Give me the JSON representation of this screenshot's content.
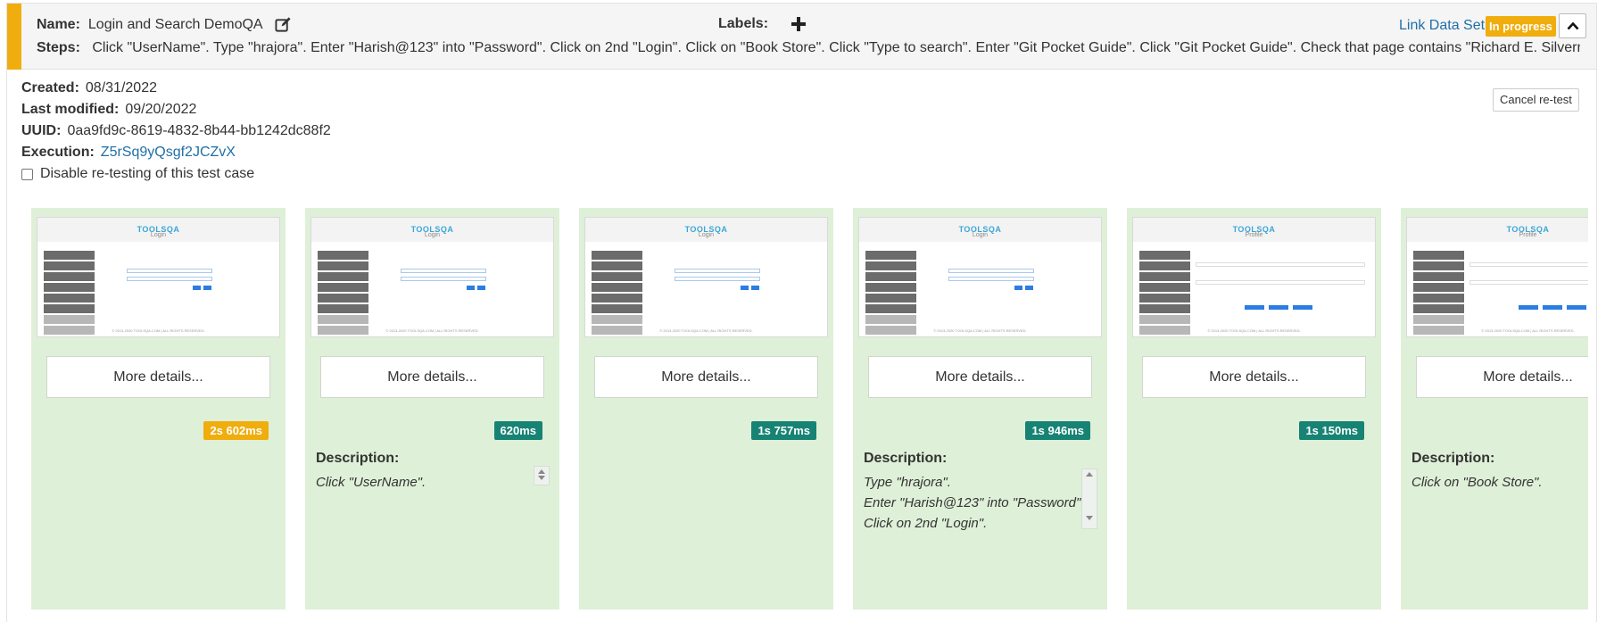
{
  "header": {
    "name_label": "Name:",
    "name_value": "Login and Search DemoQA",
    "labels_label": "Labels:",
    "steps_label": "Steps:",
    "steps_value": "Click \"UserName\". Type \"hrajora\". Enter \"Harish@123\" into \"Password\". Click on 2nd \"Login\". Click on \"Book Store\". Click \"Type to search\". Enter \"Git Pocket Guide\". Click \"Git Pocket Guide\". Check that page contains \"Richard E. Silverman\".",
    "link_data_set": "Link Data Set",
    "status_badge": "In progress",
    "accent_color": "#f0ad0e"
  },
  "meta": {
    "created_label": "Created:",
    "created_value": "08/31/2022",
    "modified_label": "Last modified:",
    "modified_value": "09/20/2022",
    "uuid_label": "UUID:",
    "uuid_value": "0aa9fd9c-8619-4832-8b44-bb1242dc88f2",
    "execution_label": "Execution:",
    "execution_value": "Z5rSq9yQsgf2JCZvX",
    "disable_retest_label": "Disable re-testing of this test case",
    "cancel_retest": "Cancel re-test"
  },
  "cards": [
    {
      "more": "More details...",
      "duration": "2s 602ms",
      "duration_color": "amber",
      "shot_title": "Login",
      "desc_label": "",
      "desc": []
    },
    {
      "more": "More details...",
      "duration": "620ms",
      "duration_color": "teal",
      "shot_title": "Login",
      "desc_label": "Description:",
      "desc": [
        "Click \"UserName\"."
      ]
    },
    {
      "more": "More details...",
      "duration": "1s 757ms",
      "duration_color": "teal",
      "shot_title": "Login",
      "desc_label": "",
      "desc": []
    },
    {
      "more": "More details...",
      "duration": "1s 946ms",
      "duration_color": "teal",
      "shot_title": "Login",
      "desc_label": "Description:",
      "desc": [
        "Type \"hrajora\".",
        "Enter \"Harish@123\" into \"Password\".",
        "Click on 2nd \"Login\"."
      ]
    },
    {
      "more": "More details...",
      "duration": "1s 150ms",
      "duration_color": "teal",
      "shot_title": "Profile",
      "desc_label": "",
      "desc": []
    },
    {
      "more": "More details...",
      "duration": "",
      "duration_color": "teal",
      "shot_title": "Profile",
      "desc_label": "Description:",
      "desc": [
        "Click on \"Book Store\"."
      ]
    }
  ],
  "screenshot_logo": "TOOLSQA"
}
